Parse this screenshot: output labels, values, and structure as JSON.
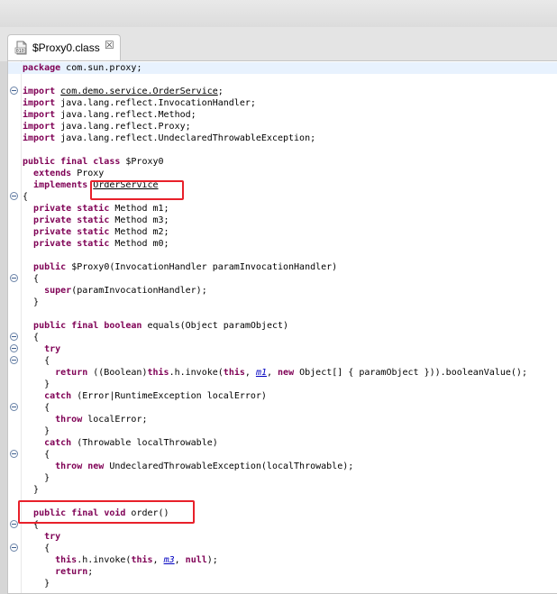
{
  "tab": {
    "label": "$Proxy0.class",
    "close_glyph": "☒"
  },
  "code": {
    "package": [
      "package",
      " com.sun.proxy;"
    ],
    "import1": [
      "import",
      " ",
      "com.demo.service.OrderService",
      ";"
    ],
    "import2": [
      "import",
      " java.lang.reflect.InvocationHandler;"
    ],
    "import3": [
      "import",
      " java.lang.reflect.Method;"
    ],
    "import4": [
      "import",
      " java.lang.reflect.Proxy;"
    ],
    "import5": [
      "import",
      " java.lang.reflect.UndeclaredThrowableException;"
    ],
    "class_decl": [
      "public final class",
      " $Proxy0"
    ],
    "extends": [
      "  ",
      "extends",
      " Proxy"
    ],
    "implements": [
      "  ",
      "implements",
      " ",
      "OrderService"
    ],
    "open_brace": "{",
    "field_m1": [
      "  ",
      "private static",
      " Method m1;"
    ],
    "field_m3": [
      "  ",
      "private static",
      " Method m3;"
    ],
    "field_m2": [
      "  ",
      "private static",
      " Method m2;"
    ],
    "field_m0": [
      "  ",
      "private static",
      " Method m0;"
    ],
    "ctor": [
      "  ",
      "public",
      " $Proxy0(InvocationHandler paramInvocationHandler)"
    ],
    "ctor_open": "  {",
    "ctor_super": [
      "    ",
      "super",
      "(paramInvocationHandler);"
    ],
    "ctor_close": "  }",
    "equals_decl": [
      "  ",
      "public final boolean",
      " equals(Object paramObject)"
    ],
    "equals_open": "  {",
    "try1": [
      "    ",
      "try"
    ],
    "try1_open": "    {",
    "return1": [
      "      ",
      "return",
      " ((Boolean)",
      "this",
      ".h.invoke(",
      "this",
      ", ",
      "m1",
      ", ",
      "new",
      " Object[] { paramObject })).booleanValue();"
    ],
    "try1_close": "    }",
    "catch1": [
      "    ",
      "catch",
      " (Error|RuntimeException localError)"
    ],
    "catch1_open": "    {",
    "throw1": [
      "      ",
      "throw",
      " localError;"
    ],
    "catch1_close": "    }",
    "catch2": [
      "    ",
      "catch",
      " (Throwable localThrowable)"
    ],
    "catch2_open": "    {",
    "throw2": [
      "      ",
      "throw new",
      " UndeclaredThrowableException(localThrowable);"
    ],
    "catch2_close": "    }",
    "equals_close": "  }",
    "order_decl": [
      "  ",
      "public final void",
      " order()"
    ],
    "order_open": "  {",
    "try2": [
      "    ",
      "try"
    ],
    "try2_open": "    {",
    "invoke2": [
      "      ",
      "this",
      ".h.invoke(",
      "this",
      ", ",
      "m3",
      ", ",
      "null",
      ");"
    ],
    "return2": [
      "      ",
      "return",
      ";"
    ],
    "try2_close": "    }"
  }
}
